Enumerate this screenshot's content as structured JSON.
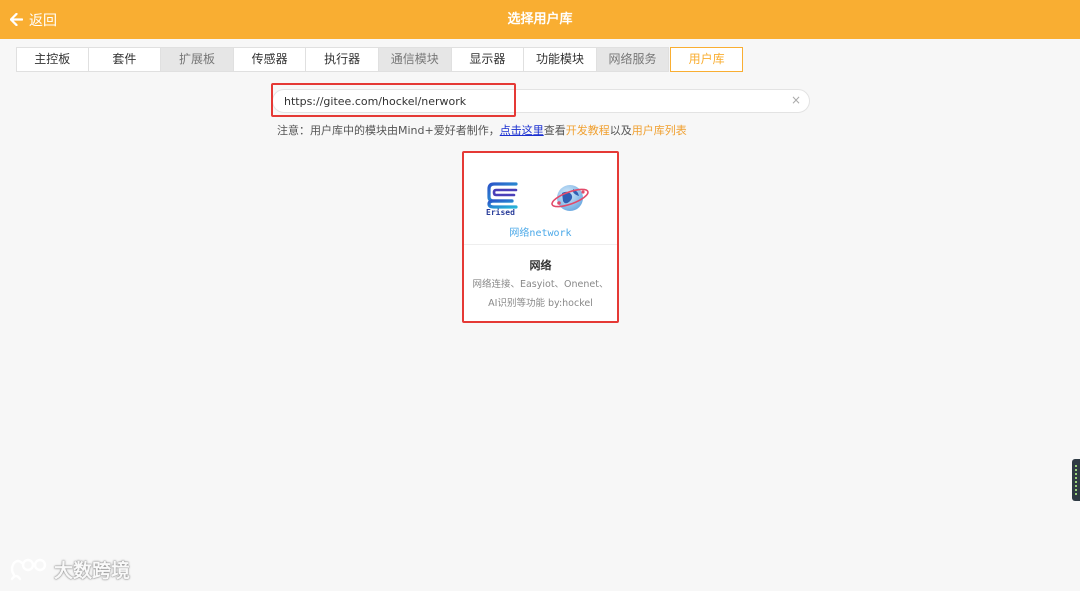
{
  "header": {
    "back_label": "返回",
    "title": "选择用户库"
  },
  "tabs": [
    {
      "label": "主控板",
      "state": "normal"
    },
    {
      "label": "套件",
      "state": "normal"
    },
    {
      "label": "扩展板",
      "state": "gray"
    },
    {
      "label": "传感器",
      "state": "normal"
    },
    {
      "label": "执行器",
      "state": "normal"
    },
    {
      "label": "通信模块",
      "state": "gray"
    },
    {
      "label": "显示器",
      "state": "normal"
    },
    {
      "label": "功能模块",
      "state": "normal"
    },
    {
      "label": "网络服务",
      "state": "gray"
    },
    {
      "label": "用户库",
      "state": "active"
    }
  ],
  "search": {
    "value": "https://gitee.com/hockel/nerwork",
    "clear_icon": "×"
  },
  "notice": {
    "prefix": "注意：用户库中的模块由Mind+爱好者制作，",
    "link_here": "点击这里",
    "middle": "查看",
    "dev_tutorial": "开发教程",
    "and": "以及",
    "user_lib_list": "用户库列表"
  },
  "card": {
    "logo_caption": "网络network",
    "logo_text": "Erised",
    "name": "网络",
    "desc_line1": "网络连接、Easyiot、Onenet、",
    "desc_line2": "AI识别等功能 by:hockel"
  },
  "watermark": {
    "text": "大数跨境"
  },
  "colors": {
    "accent": "#f9ae32",
    "highlight": "#e53935",
    "link": "#1a2fd0"
  }
}
